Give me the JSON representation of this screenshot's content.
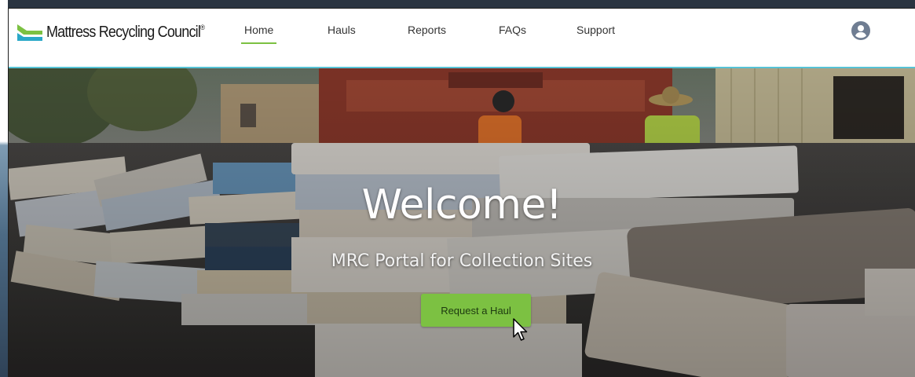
{
  "brand": {
    "name": "Mattress Recycling Council",
    "trademark": "®",
    "logo_colors": [
      "#7cc142",
      "#2aa8c8"
    ]
  },
  "nav": {
    "items": [
      {
        "label": "Home",
        "active": true
      },
      {
        "label": "Hauls",
        "active": false
      },
      {
        "label": "Reports",
        "active": false
      },
      {
        "label": "FAQs",
        "active": false
      },
      {
        "label": "Support",
        "active": false
      }
    ],
    "user_icon": "user-circle-icon"
  },
  "hero": {
    "title": "Welcome!",
    "subtitle": "MRC Portal for Collection Sites",
    "cta_label": "Request a Haul"
  },
  "colors": {
    "accent": "#7cc142",
    "header_border": "#56c3d6"
  }
}
